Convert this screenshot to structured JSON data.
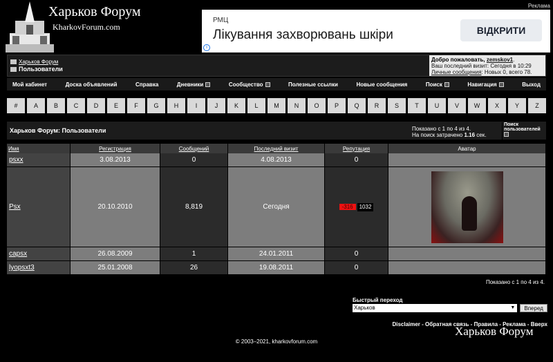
{
  "ad_corner_label": "Реклама",
  "logo": {
    "title": "Харьков Форум",
    "url": "KharkovForum.com"
  },
  "ad": {
    "small": "РМЦ",
    "title": "Лікування захворювань шкіри",
    "button": "ВІДКРИТИ",
    "info_icon": "i"
  },
  "breadcrumb": {
    "parent": "Харьков Форум",
    "current": "Пользователи"
  },
  "welcome": {
    "greeting": "Добро пожаловать,",
    "username": "zemskov1",
    "last_visit": "Ваш последний визит: Сегодня в 10:29",
    "pm_label": "Личные сообщения",
    "pm_stats": ": Новых 0, всего 78."
  },
  "menu": [
    {
      "label": "Мой кабинет",
      "dropdown": false
    },
    {
      "label": "Доска объявлений",
      "dropdown": false
    },
    {
      "label": "Справка",
      "dropdown": false
    },
    {
      "label": "Дневники",
      "dropdown": true
    },
    {
      "label": "Сообщество",
      "dropdown": true
    },
    {
      "label": "Полезные ссылки",
      "dropdown": false
    },
    {
      "label": "Новые сообщения",
      "dropdown": false
    },
    {
      "label": "Поиск",
      "dropdown": true
    },
    {
      "label": "Навигация",
      "dropdown": true
    },
    {
      "label": "Выход",
      "dropdown": false
    }
  ],
  "letters": [
    "#",
    "A",
    "B",
    "C",
    "D",
    "E",
    "F",
    "G",
    "H",
    "I",
    "J",
    "K",
    "L",
    "M",
    "N",
    "O",
    "P",
    "Q",
    "R",
    "S",
    "T",
    "U",
    "V",
    "W",
    "X",
    "Y",
    "Z"
  ],
  "title_bar": {
    "title": "Харьков Форум: Пользователи",
    "shown_line": "Показано с 1 по 4 из 4.",
    "search_time_prefix": "На поиск затрачено ",
    "search_time": "1.16",
    "search_time_suffix": " сек.",
    "search_users": "Поиск пользователей"
  },
  "table": {
    "headers": [
      "Имя",
      "Регистрация",
      "Сообщений",
      "Последний визит",
      "Репутация",
      "Аватар"
    ],
    "rows": [
      {
        "name": "psxx",
        "registered": "3.08.2013",
        "posts": "0",
        "last_visit": "4.08.2013",
        "reputation": "0"
      },
      {
        "name": "Psx",
        "registered": "20.10.2010",
        "posts": "8,819",
        "last_visit": "Сегодня",
        "reputation_neg": "-316",
        "reputation": "1032"
      },
      {
        "name": "capsx",
        "registered": "26.08.2009",
        "posts": "1",
        "last_visit": "24.01.2011",
        "reputation": "0"
      },
      {
        "name": "lyopsxt3",
        "registered": "25.01.2008",
        "posts": "26",
        "last_visit": "19.08.2011",
        "reputation": "0"
      }
    ]
  },
  "shown_bottom": "Показано с 1 по 4 из 4.",
  "jump": {
    "label": "Быстрый переход",
    "selected": "Харьков",
    "button": "Вперед"
  },
  "footer": {
    "links": [
      "Disclaimer",
      "Обратная связь",
      "Правила",
      "Реклама",
      "Вверх"
    ],
    "separator": " - "
  },
  "watermark": "Харьков Форум",
  "copyright": "© 2003–2021, kharkovforum.com"
}
